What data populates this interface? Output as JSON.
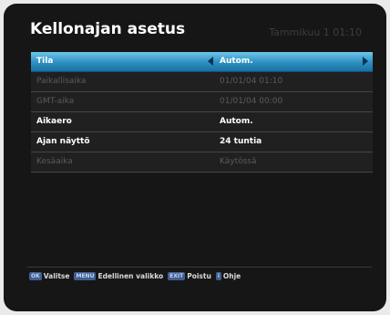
{
  "header": {
    "title": "Kellonajan asetus",
    "clock": "Tammikuu 1 01:10"
  },
  "menu": {
    "rows": [
      {
        "label": "Tila",
        "value": "Autom.",
        "state": "selected"
      },
      {
        "label": "Paikallisaika",
        "value": "01/01/04 01:10",
        "state": "disabled"
      },
      {
        "label": "GMT-aika",
        "value": "01/01/04 00:00",
        "state": "disabled"
      },
      {
        "label": "Aikaero",
        "value": "Autom.",
        "state": "enabled"
      },
      {
        "label": "Ajan näyttö",
        "value": "24 tuntia",
        "state": "enabled"
      },
      {
        "label": "Kesäaika",
        "value": "Käytössä",
        "state": "disabled"
      }
    ]
  },
  "footer": {
    "ok_key": "OK",
    "ok_label": "Valitse",
    "menu_key": "MENU",
    "menu_label": "Edellinen valikko",
    "exit_key": "EXIT",
    "exit_label": "Poistu",
    "help_key": "i",
    "help_label": "Ohje"
  },
  "colors": {
    "background": "#161616",
    "selection": "#2d8fc1",
    "key_badge": "#3f5f93"
  }
}
